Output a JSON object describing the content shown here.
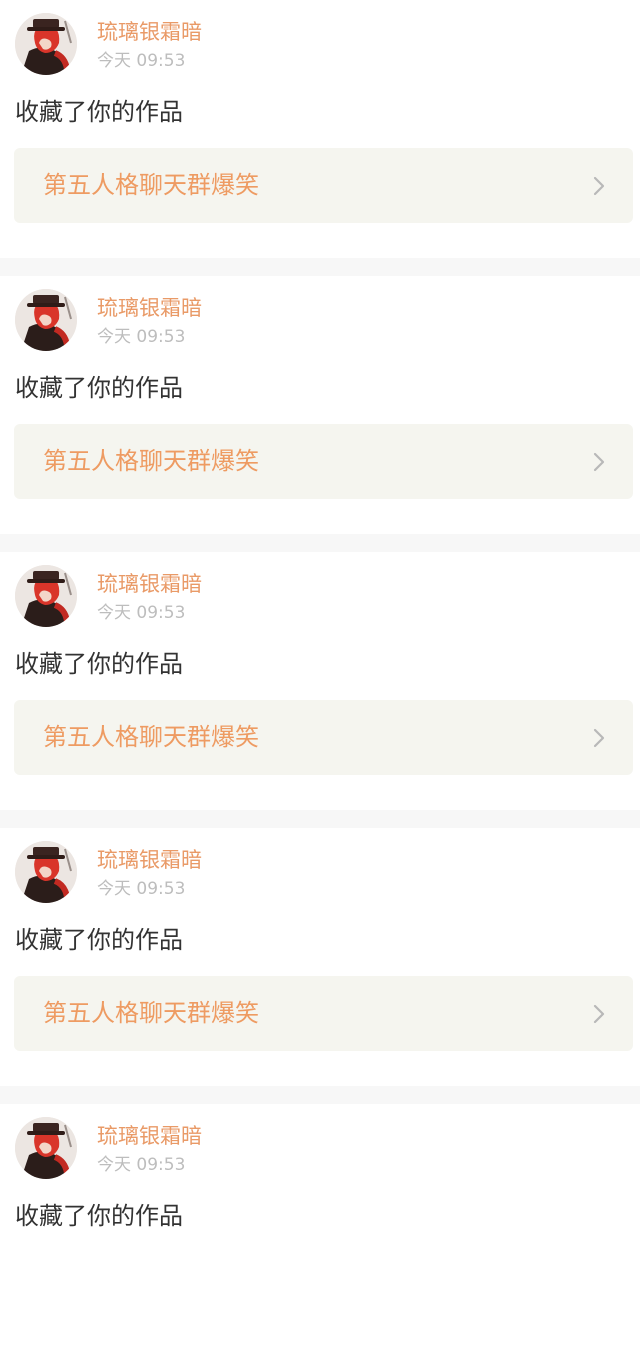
{
  "colors": {
    "username": "#e99a67",
    "time": "#bdbdbd",
    "action_text": "#333333",
    "work_title": "#ee9b62",
    "work_box_bg": "#f5f5ef",
    "separator": "#f7f7f7"
  },
  "notifications": [
    {
      "avatar_icon": "user-avatar-red-hair-top-hat",
      "username": "琉璃银霜暗",
      "time": "今天 09:53",
      "action": "收藏了你的作品",
      "work_title": "第五人格聊天群爆笑",
      "chevron_icon": "chevron-right-icon"
    },
    {
      "avatar_icon": "user-avatar-red-hair-top-hat",
      "username": "琉璃银霜暗",
      "time": "今天 09:53",
      "action": "收藏了你的作品",
      "work_title": "第五人格聊天群爆笑",
      "chevron_icon": "chevron-right-icon"
    },
    {
      "avatar_icon": "user-avatar-red-hair-top-hat",
      "username": "琉璃银霜暗",
      "time": "今天 09:53",
      "action": "收藏了你的作品",
      "work_title": "第五人格聊天群爆笑",
      "chevron_icon": "chevron-right-icon"
    },
    {
      "avatar_icon": "user-avatar-red-hair-top-hat",
      "username": "琉璃银霜暗",
      "time": "今天 09:53",
      "action": "收藏了你的作品",
      "work_title": "第五人格聊天群爆笑",
      "chevron_icon": "chevron-right-icon"
    },
    {
      "avatar_icon": "user-avatar-red-hair-top-hat",
      "username": "琉璃银霜暗",
      "time": "今天 09:53",
      "action": "收藏了你的作品",
      "work_title": "",
      "chevron_icon": "chevron-right-icon"
    }
  ]
}
